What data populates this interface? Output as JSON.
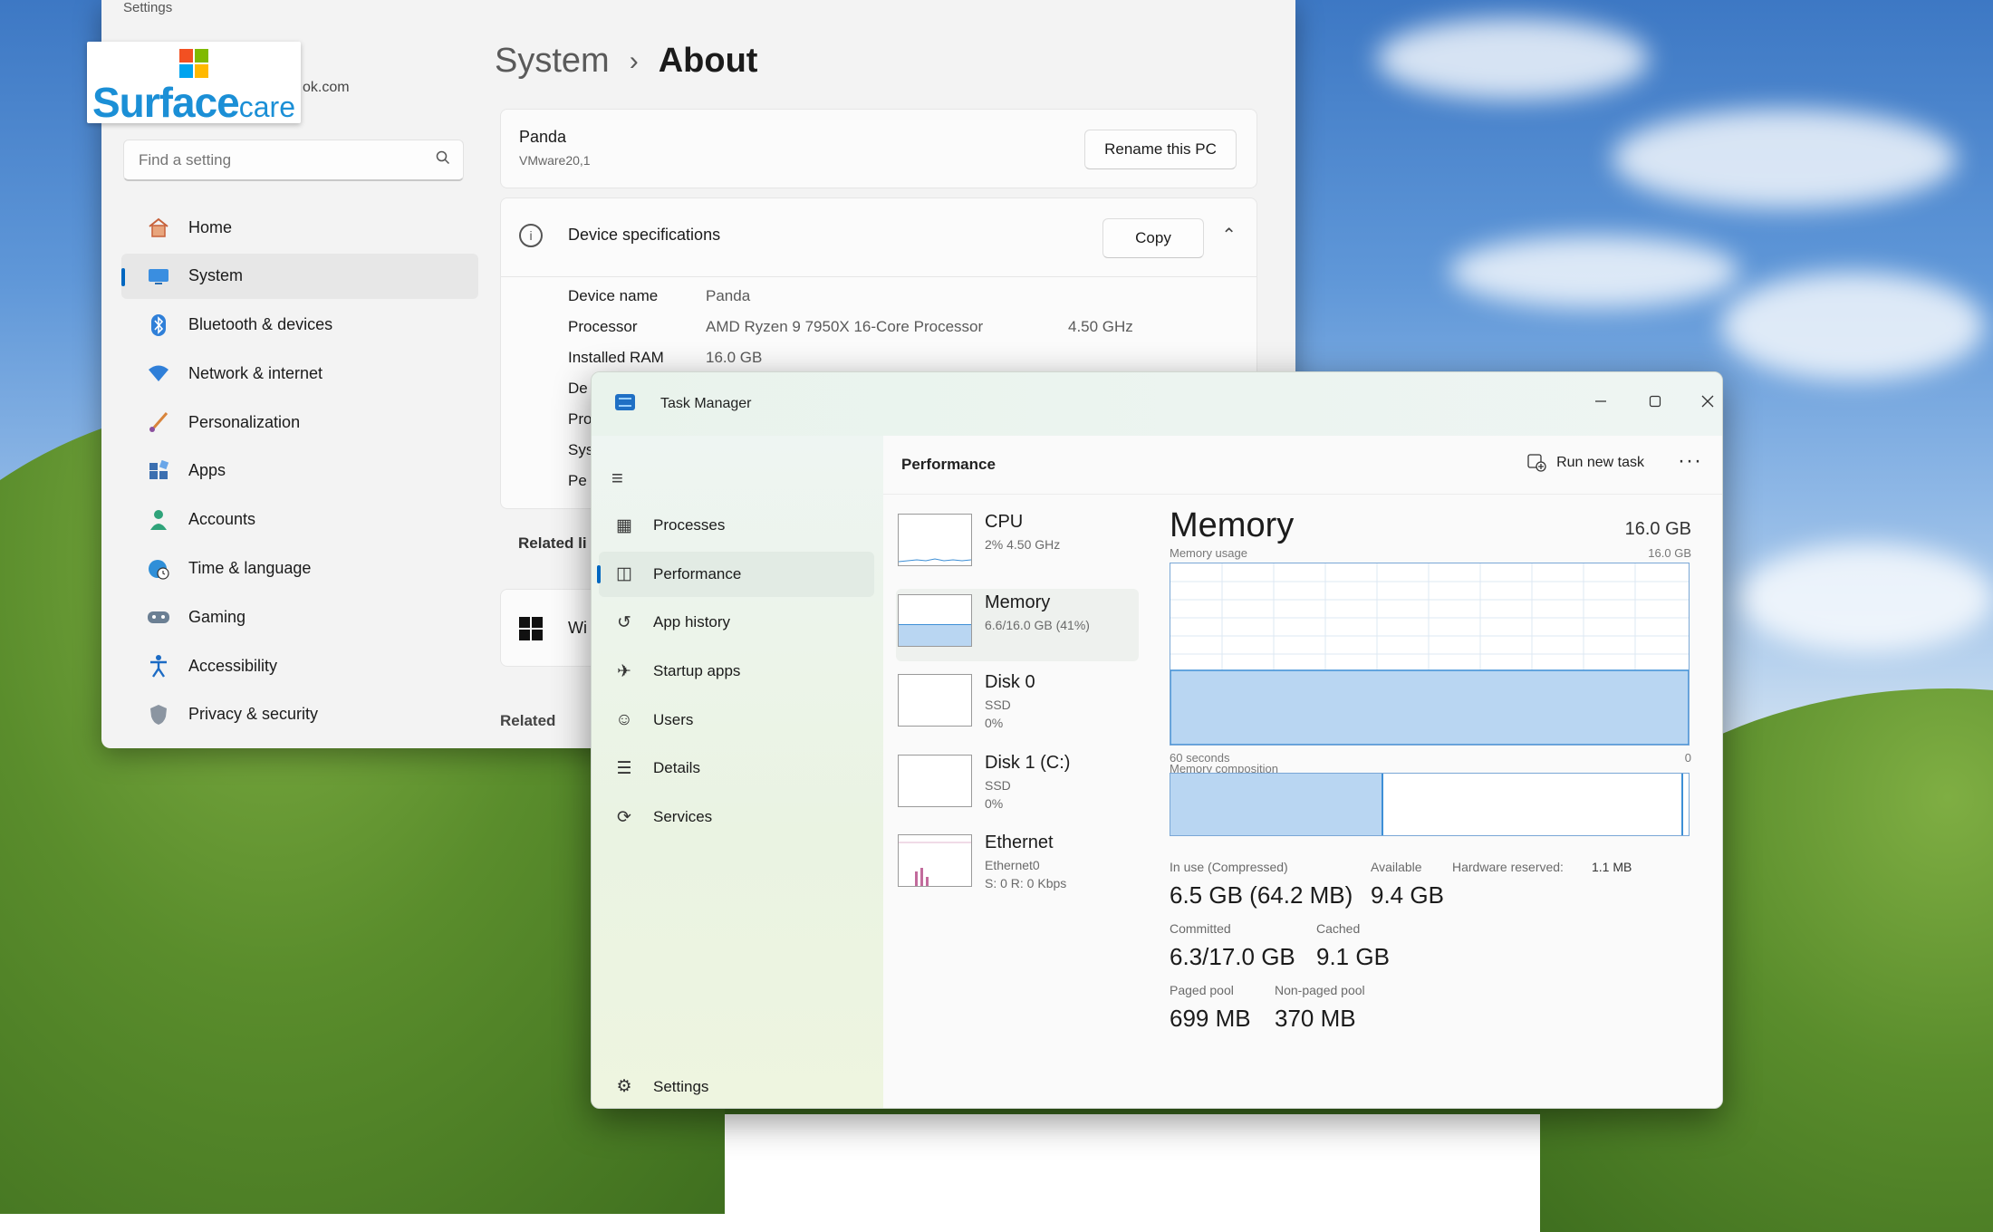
{
  "logo": {
    "text_main": "Surface",
    "text_accent": "care"
  },
  "settings": {
    "window_title": "Settings",
    "account_email_fragment": "ok.com",
    "search": {
      "placeholder": "Find a setting"
    },
    "nav": [
      {
        "label": "Home",
        "icon": "home-icon",
        "active": false
      },
      {
        "label": "System",
        "icon": "display-icon",
        "active": true
      },
      {
        "label": "Bluetooth & devices",
        "icon": "bluetooth-icon",
        "active": false
      },
      {
        "label": "Network & internet",
        "icon": "wifi-icon",
        "active": false
      },
      {
        "label": "Personalization",
        "icon": "brush-icon",
        "active": false
      },
      {
        "label": "Apps",
        "icon": "apps-icon",
        "active": false
      },
      {
        "label": "Accounts",
        "icon": "person-icon",
        "active": false
      },
      {
        "label": "Time & language",
        "icon": "globe-clock-icon",
        "active": false
      },
      {
        "label": "Gaming",
        "icon": "gamepad-icon",
        "active": false
      },
      {
        "label": "Accessibility",
        "icon": "accessibility-icon",
        "active": false
      },
      {
        "label": "Privacy & security",
        "icon": "shield-icon",
        "active": false
      }
    ],
    "breadcrumb": {
      "parent": "System",
      "separator": "›",
      "current": "About"
    },
    "pc": {
      "name": "Panda",
      "model": "VMware20,1",
      "rename_label": "Rename this PC"
    },
    "device_specs": {
      "title": "Device specifications",
      "copy_label": "Copy",
      "rows": [
        {
          "label": "Device name",
          "value": "Panda",
          "extra": ""
        },
        {
          "label": "Processor",
          "value": "AMD Ryzen 9 7950X 16-Core Processor",
          "extra": "4.50 GHz"
        },
        {
          "label": "Installed RAM",
          "value": "16.0 GB",
          "extra": ""
        },
        {
          "label": "De",
          "value": "",
          "extra": ""
        },
        {
          "label": "Pro",
          "value": "",
          "extra": ""
        },
        {
          "label": "Sys",
          "value": "",
          "extra": ""
        },
        {
          "label": "Pe",
          "value": "",
          "extra": ""
        }
      ]
    },
    "related_links_fragment": "Related li",
    "windows_card_fragment": "Wi",
    "related_label": "Related"
  },
  "task_manager": {
    "title": "Task Manager",
    "nav": [
      {
        "label": "Processes",
        "icon": "processes-icon",
        "active": false
      },
      {
        "label": "Performance",
        "icon": "performance-icon",
        "active": true
      },
      {
        "label": "App history",
        "icon": "history-icon",
        "active": false
      },
      {
        "label": "Startup apps",
        "icon": "startup-icon",
        "active": false
      },
      {
        "label": "Users",
        "icon": "users-icon",
        "active": false
      },
      {
        "label": "Details",
        "icon": "details-icon",
        "active": false
      },
      {
        "label": "Services",
        "icon": "services-icon",
        "active": false
      }
    ],
    "settings_label": "Settings",
    "performance_title": "Performance",
    "run_new_task_label": "Run new task",
    "resources": [
      {
        "name": "CPU",
        "line1": "2% 4.50 GHz",
        "line2": "",
        "active": false
      },
      {
        "name": "Memory",
        "line1": "6.6/16.0 GB (41%)",
        "line2": "",
        "active": true
      },
      {
        "name": "Disk 0",
        "line1": "SSD",
        "line2": "0%",
        "active": false
      },
      {
        "name": "Disk 1 (C:)",
        "line1": "SSD",
        "line2": "0%",
        "active": false
      },
      {
        "name": "Ethernet",
        "line1": "Ethernet0",
        "line2": "S: 0 R: 0 Kbps",
        "active": false
      }
    ],
    "memory": {
      "title": "Memory",
      "total": "16.0 GB",
      "usage_label": "Memory usage",
      "usage_max": "16.0 GB",
      "time_label": "60 seconds",
      "time_end": "0",
      "usage_fraction": 0.41,
      "composition_label": "Memory composition",
      "in_use_fraction": 0.41,
      "stats": {
        "in_use_label": "In use (Compressed)",
        "in_use_value": "6.5 GB (64.2 MB)",
        "available_label": "Available",
        "available_value": "9.4 GB",
        "hw_reserved_label": "Hardware reserved:",
        "hw_reserved_value": "1.1 MB",
        "committed_label": "Committed",
        "committed_value": "6.3/17.0 GB",
        "cached_label": "Cached",
        "cached_value": "9.1 GB",
        "paged_label": "Paged pool",
        "paged_value": "699 MB",
        "nonpaged_label": "Non-paged pool",
        "nonpaged_value": "370 MB"
      }
    }
  }
}
